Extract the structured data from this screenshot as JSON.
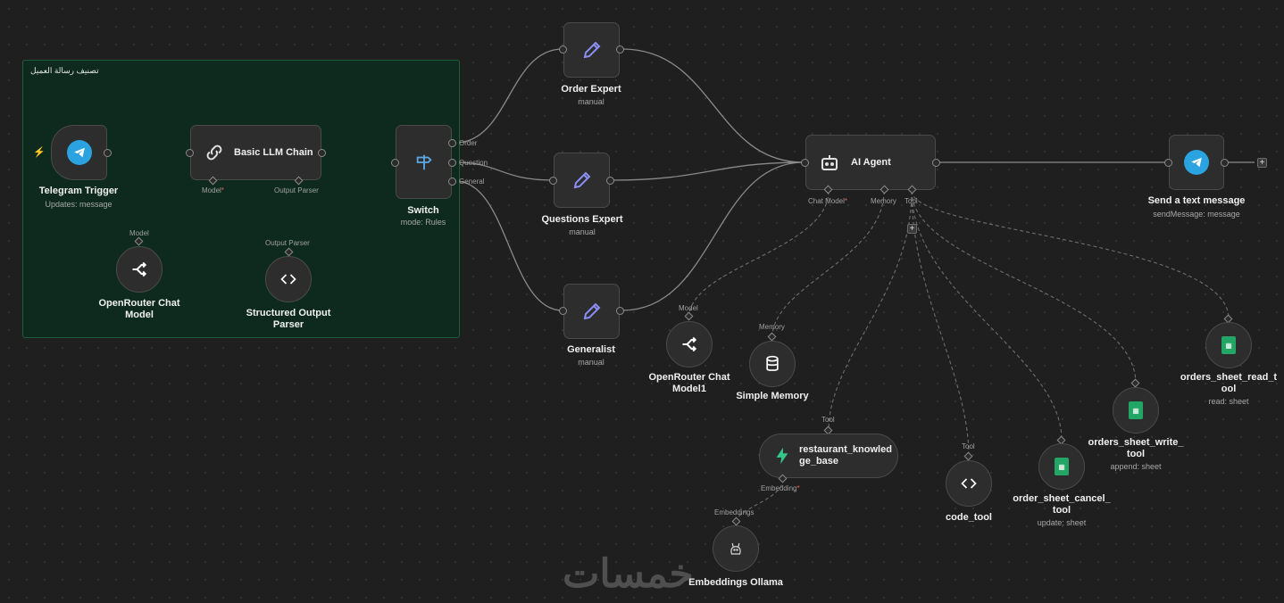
{
  "sticky": {
    "title": "تصنيف رسالة العميل"
  },
  "nodes": {
    "telegram_trigger": {
      "name": "Telegram Trigger",
      "sub": "Updates: message"
    },
    "basic_llm_chain": {
      "name": "Basic LLM Chain",
      "port_model": "Model",
      "port_parser": "Output Parser"
    },
    "switch": {
      "name": "Switch",
      "sub": "mode: Rules",
      "out_order": "Order",
      "out_question": "Question",
      "out_general": "General"
    },
    "openrouter_chat_model": {
      "name": "OpenRouter Chat Model",
      "port": "Model"
    },
    "structured_output_parser": {
      "name": "Structured Output Parser",
      "port": "Output Parser"
    },
    "order_expert": {
      "name": "Order Expert",
      "sub": "manual"
    },
    "questions_expert": {
      "name": "Questions Expert",
      "sub": "manual"
    },
    "generalist": {
      "name": "Generalist",
      "sub": "manual"
    },
    "ai_agent": {
      "name": "AI Agent",
      "port_chat": "Chat Model",
      "port_memory": "Memory",
      "port_tool": "Tool"
    },
    "send_text": {
      "name": "Send a text message",
      "sub": "sendMessage: message"
    },
    "openrouter_chat_model1": {
      "name": "OpenRouter Chat Model1",
      "port": "Model"
    },
    "simple_memory": {
      "name": "Simple Memory",
      "port": "Memory"
    },
    "knowledge_base": {
      "name": "restaurant_knowledge_base",
      "port": "Tool",
      "port_embedding": "Embedding"
    },
    "embeddings_ollama": {
      "name": "Embeddings Ollama",
      "port": "Embeddings"
    },
    "code_tool": {
      "name": "code_tool",
      "port": "Tool"
    },
    "cancel_tool": {
      "name": "order_sheet_cancel_tool",
      "sub": "update: sheet"
    },
    "write_tool": {
      "name": "orders_sheet_write_tool",
      "sub": "append: sheet"
    },
    "read_tool": {
      "name": "orders_sheet_read_tool",
      "sub": "read: sheet"
    }
  },
  "watermark": "خمسات",
  "colors": {
    "canvas": "#1f1f1f",
    "sticky": "#0e2a1e",
    "node": "#2d2d2d",
    "telegram": "#2aa3e0",
    "sheets": "#23a566",
    "pen": "#8b8ff5",
    "required": "#ff5a5a"
  },
  "icons": {
    "telegram_trigger": "telegram-icon",
    "basic_llm_chain": "link-icon",
    "switch": "signpost-icon",
    "openrouter": "openrouter-icon",
    "parser": "code-brackets-icon",
    "experts": "pen-icon",
    "ai_agent": "robot-icon",
    "memory": "database-icon",
    "knowledge": "bolt-icon",
    "ollama": "llama-icon",
    "sheets": "google-sheets-icon"
  }
}
